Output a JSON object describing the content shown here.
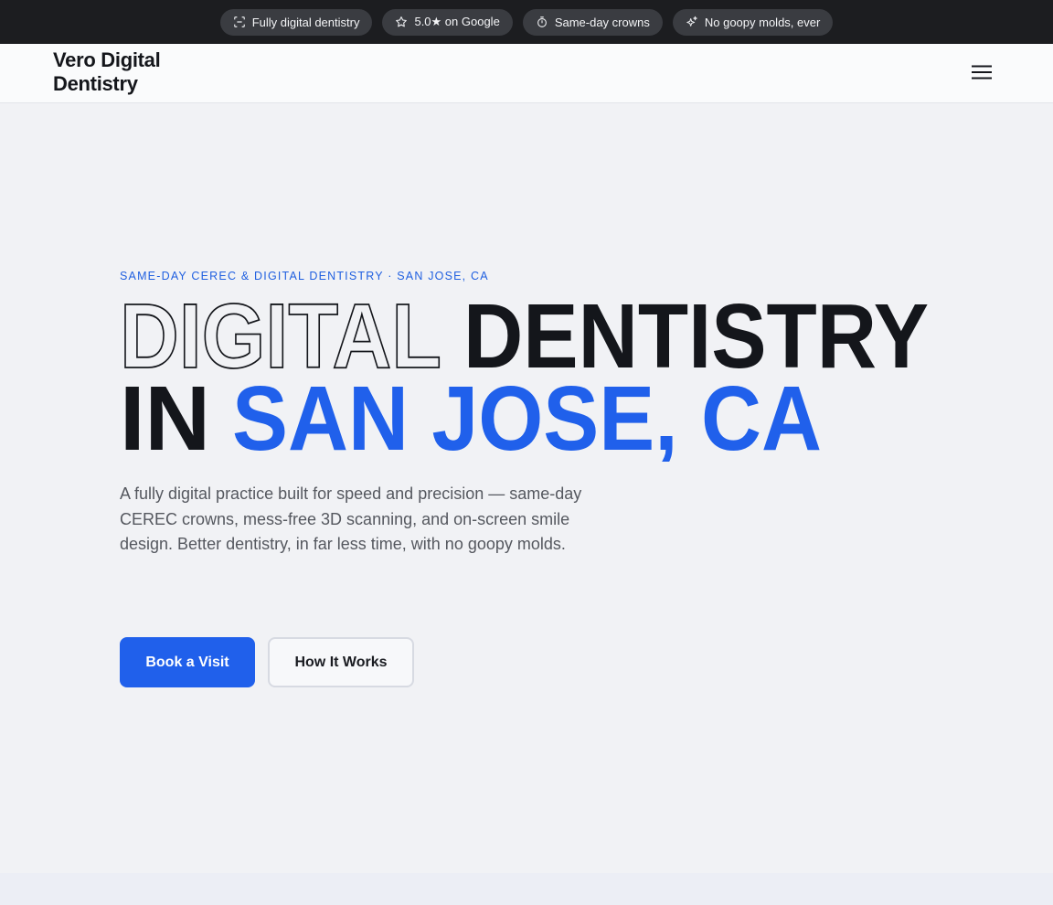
{
  "announcement": {
    "items": [
      {
        "icon": "scan-icon",
        "label": "Fully digital dentistry"
      },
      {
        "icon": "star-icon",
        "label": "5.0★ on Google"
      },
      {
        "icon": "timer-icon",
        "label": "Same-day crowns"
      },
      {
        "icon": "sparkles-icon",
        "label": "No goopy molds, ever"
      }
    ]
  },
  "header": {
    "brand_line1": "Vero Digital",
    "brand_line2": "Dentistry",
    "menu_icon": "hamburger-menu-icon"
  },
  "hero": {
    "eyebrow": "SAME-DAY CEREC & DIGITAL DENTISTRY · SAN JOSE, CA",
    "headline_outline": "DIGITAL",
    "headline_solid": "DENTISTRY",
    "headline_in": "IN",
    "headline_accent": "SAN JOSE, CA",
    "lead": "A fully digital practice built for speed and precision — same-day CEREC crowns, mess-free 3D scanning, and on-screen smile design. Better dentistry, in far less time, with no goopy molds.",
    "primary_button": "Book a Visit",
    "secondary_button": "How It Works"
  },
  "colors": {
    "accent": "#2060eb",
    "topbar": "#1c1d20",
    "text_dark": "#14161b"
  }
}
